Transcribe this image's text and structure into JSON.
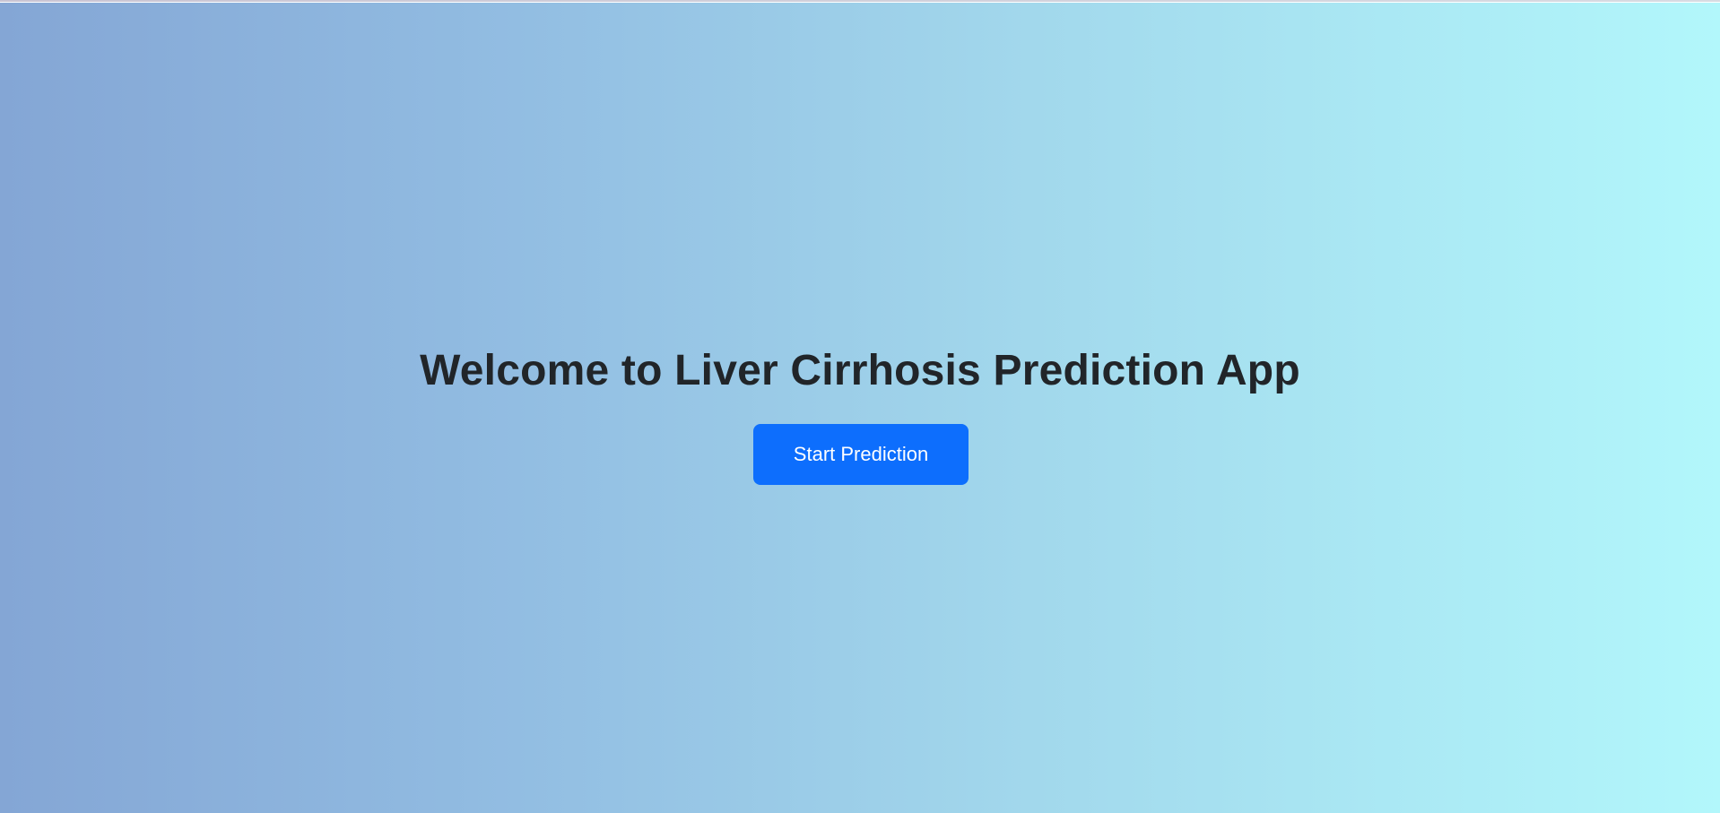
{
  "hero": {
    "title": "Welcome to Liver Cirrhosis Prediction App",
    "button_label": "Start Prediction"
  },
  "colors": {
    "gradient_start": "#84a6d5",
    "gradient_end": "#b2f7fb",
    "title_text": "#212529",
    "button_background": "#0d6efd",
    "button_text": "#ffffff"
  }
}
